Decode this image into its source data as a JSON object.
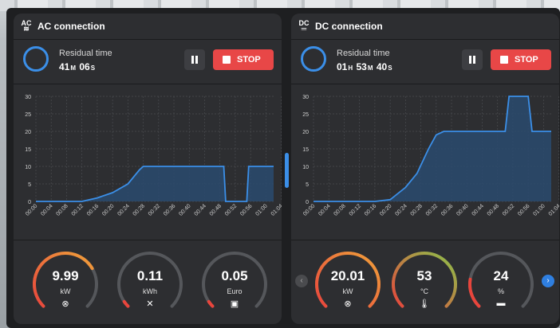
{
  "colors": {
    "accent": "#3b8fe8",
    "stop": "#e84747",
    "panel": "#2d2e31",
    "gauge_track": "#55575b"
  },
  "ac": {
    "title": "AC connection",
    "icon": "ac-plug-icon",
    "residual_label": "Residual time",
    "residual": {
      "m": "41",
      "m_unit": "M",
      "s": "06",
      "s_unit": "S"
    },
    "pause_icon": "pause-icon",
    "stop_label": "STOP",
    "gauges": [
      {
        "value": "9.99",
        "unit": "kW",
        "icon": "power-icon",
        "level": 0.72,
        "colors": [
          "#e8453c",
          "#f0a13a"
        ]
      },
      {
        "value": "0.11",
        "unit": "kWh",
        "icon": "energy-icon",
        "level": 0.0,
        "colors": [
          "#e8453c",
          "#e8453c"
        ]
      },
      {
        "value": "0.05",
        "unit": "Euro",
        "icon": "wallet-icon",
        "level": 0.0,
        "colors": [
          "#e8453c",
          "#e8453c"
        ]
      }
    ]
  },
  "dc": {
    "title": "DC connection",
    "icon": "dc-plug-icon",
    "residual_label": "Residual time",
    "residual": {
      "h": "01",
      "h_unit": "H",
      "m": "53",
      "m_unit": "M",
      "s": "40",
      "s_unit": "S"
    },
    "pause_icon": "pause-icon",
    "stop_label": "STOP",
    "gauges": [
      {
        "value": "20.01",
        "unit": "kW",
        "icon": "power-icon",
        "level": 1.0,
        "colors": [
          "#e8453c",
          "#f0a13a"
        ]
      },
      {
        "value": "53",
        "unit": "°C",
        "icon": "thermometer-icon",
        "level": 1.0,
        "colors": [
          "#e8453c",
          "#8bc34a"
        ]
      },
      {
        "value": "24",
        "unit": "%",
        "icon": "battery-icon",
        "level": 0.2,
        "colors": [
          "#e8453c",
          "#e8453c"
        ]
      }
    ]
  },
  "chart_data": [
    {
      "type": "area",
      "title": "",
      "x": [
        "00:00",
        "00:04",
        "00:08",
        "00:12",
        "00:16",
        "00:20",
        "00:24",
        "00:28",
        "00:32",
        "00:36",
        "00:40",
        "00:44",
        "00:48",
        "00:52",
        "00:56",
        "01:00",
        "01:04"
      ],
      "series": [
        {
          "values": [
            {
              "t": 0,
              "v": 0
            },
            {
              "t": 12,
              "v": 0
            },
            {
              "t": 16,
              "v": 1
            },
            {
              "t": 20,
              "v": 2.5
            },
            {
              "t": 24,
              "v": 5
            },
            {
              "t": 27,
              "v": 9
            },
            {
              "t": 28,
              "v": 10
            },
            {
              "t": 49,
              "v": 10
            },
            {
              "t": 49.5,
              "v": 0
            },
            {
              "t": 55,
              "v": 0
            },
            {
              "t": 55.5,
              "v": 10
            },
            {
              "t": 62,
              "v": 10
            }
          ]
        }
      ],
      "yticks": [
        0,
        5,
        10,
        15,
        20,
        25,
        30
      ],
      "ylim": [
        0,
        30
      ],
      "xlim": [
        0,
        62
      ],
      "grid": true
    },
    {
      "type": "area",
      "title": "",
      "x": [
        "00:00",
        "00:04",
        "00:08",
        "00:12",
        "00:16",
        "00:20",
        "00:24",
        "00:28",
        "00:32",
        "00:36",
        "00:40",
        "00:44",
        "00:48",
        "00:52",
        "00:56",
        "01:00",
        "01:04"
      ],
      "series": [
        {
          "values": [
            {
              "t": 0,
              "v": 0
            },
            {
              "t": 16,
              "v": 0
            },
            {
              "t": 20,
              "v": 0.5
            },
            {
              "t": 24,
              "v": 4
            },
            {
              "t": 27,
              "v": 8
            },
            {
              "t": 30,
              "v": 15
            },
            {
              "t": 32,
              "v": 19
            },
            {
              "t": 34,
              "v": 20
            },
            {
              "t": 50,
              "v": 20
            },
            {
              "t": 51,
              "v": 30
            },
            {
              "t": 56,
              "v": 30
            },
            {
              "t": 57,
              "v": 20
            },
            {
              "t": 62,
              "v": 20
            }
          ]
        }
      ],
      "yticks": [
        0,
        5,
        10,
        15,
        20,
        25,
        30
      ],
      "ylim": [
        0,
        30
      ],
      "xlim": [
        0,
        62
      ],
      "grid": true
    }
  ],
  "nav": {
    "prev": "‹",
    "next": "›"
  }
}
